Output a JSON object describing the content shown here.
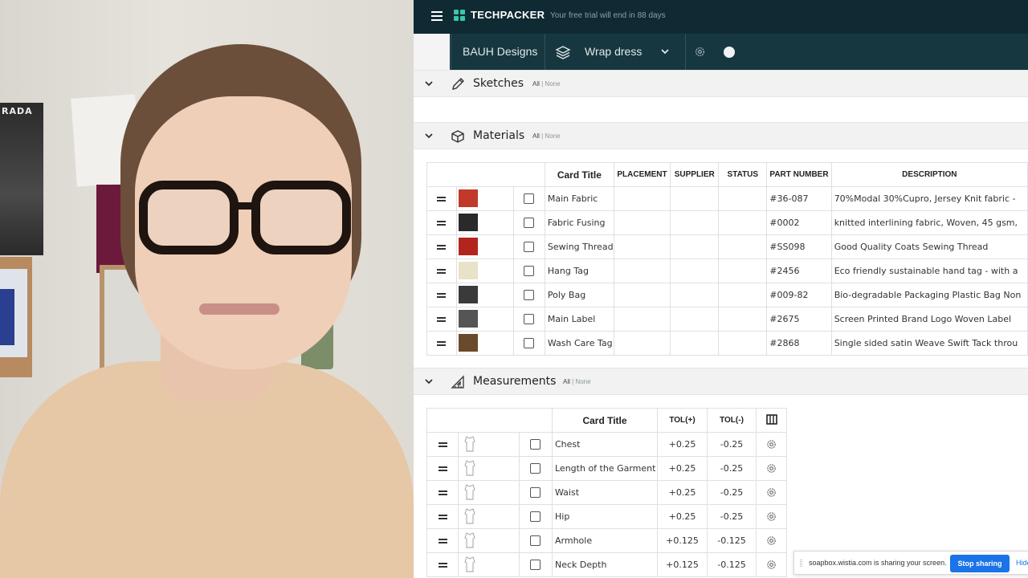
{
  "colors": {
    "topbar": "#0f2a33",
    "subbar": "#173740",
    "accent": "#3ac7a8",
    "share_button": "#1a73e8"
  },
  "topbar": {
    "menu_icon": "hamburger-icon",
    "logo_icon": "techpacker-logo",
    "brand": "TECHPACKER",
    "trial_notice": "Your free trial will end in 88 days"
  },
  "subbar": {
    "brand": "BAUH Designs",
    "product_icon": "layers-icon",
    "product": "Wrap dress",
    "settings_icon": "gear-icon"
  },
  "sections": {
    "sketches": {
      "title": "Sketches",
      "icon": "pencil-icon",
      "all": "All",
      "none": "| None"
    },
    "materials": {
      "title": "Materials",
      "icon": "box-icon",
      "all": "All",
      "none": "| None"
    },
    "measurements": {
      "title": "Measurements",
      "icon": "triangle-ruler-icon",
      "all": "All",
      "none": "| None"
    }
  },
  "materials": {
    "headers": [
      "Card Title",
      "PLACEMENT",
      "SUPPLIER",
      "STATUS",
      "PART NUMBER",
      "DESCRIPTION"
    ],
    "rows": [
      {
        "title": "Main Fabric",
        "part": "#36-087",
        "desc": "70%Modal 30%Cupro, Jersey Knit fabric -",
        "swatch": "#c0392b"
      },
      {
        "title": "Fabric Fusing",
        "part": "#0002",
        "desc": "knitted interlining fabric, Woven, 45 gsm,",
        "swatch": "#2a2a2a"
      },
      {
        "title": "Sewing Thread",
        "part": "#SS098",
        "desc": "Good Quality Coats Sewing Thread",
        "swatch": "#b3241c"
      },
      {
        "title": "Hang Tag",
        "part": "#2456",
        "desc": "Eco friendly sustainable hand tag - with a",
        "swatch": "#e8e2c8"
      },
      {
        "title": "Poly Bag",
        "part": "#009-82",
        "desc": "Bio-degradable Packaging Plastic Bag Non",
        "swatch": "#3a3a3a"
      },
      {
        "title": "Main Label",
        "part": "#2675",
        "desc": "Screen Printed Brand Logo Woven Label",
        "swatch": "#555555"
      },
      {
        "title": "Wash Care Tag",
        "part": "#2868",
        "desc": "Single sided satin Weave Swift Tack throu",
        "swatch": "#6b4a2b"
      }
    ]
  },
  "measurements": {
    "headers": [
      "Card Title",
      "TOL(+)",
      "TOL(-)"
    ],
    "columns_icon": "columns-icon",
    "rows": [
      {
        "title": "Chest",
        "plus": "+0.25",
        "minus": "-0.25"
      },
      {
        "title": "Length of the Garment",
        "plus": "+0.25",
        "minus": "-0.25"
      },
      {
        "title": "Waist",
        "plus": "+0.25",
        "minus": "-0.25"
      },
      {
        "title": "Hip",
        "plus": "+0.25",
        "minus": "-0.25"
      },
      {
        "title": "Armhole",
        "plus": "+0.125",
        "minus": "-0.125"
      },
      {
        "title": "Neck Depth",
        "plus": "+0.125",
        "minus": "-0.125"
      }
    ]
  },
  "share_bar": {
    "message": "soapbox.wistia.com is sharing your screen.",
    "stop": "Stop sharing",
    "hide": "Hide"
  },
  "webcam": {
    "poster_text": "RADA"
  }
}
